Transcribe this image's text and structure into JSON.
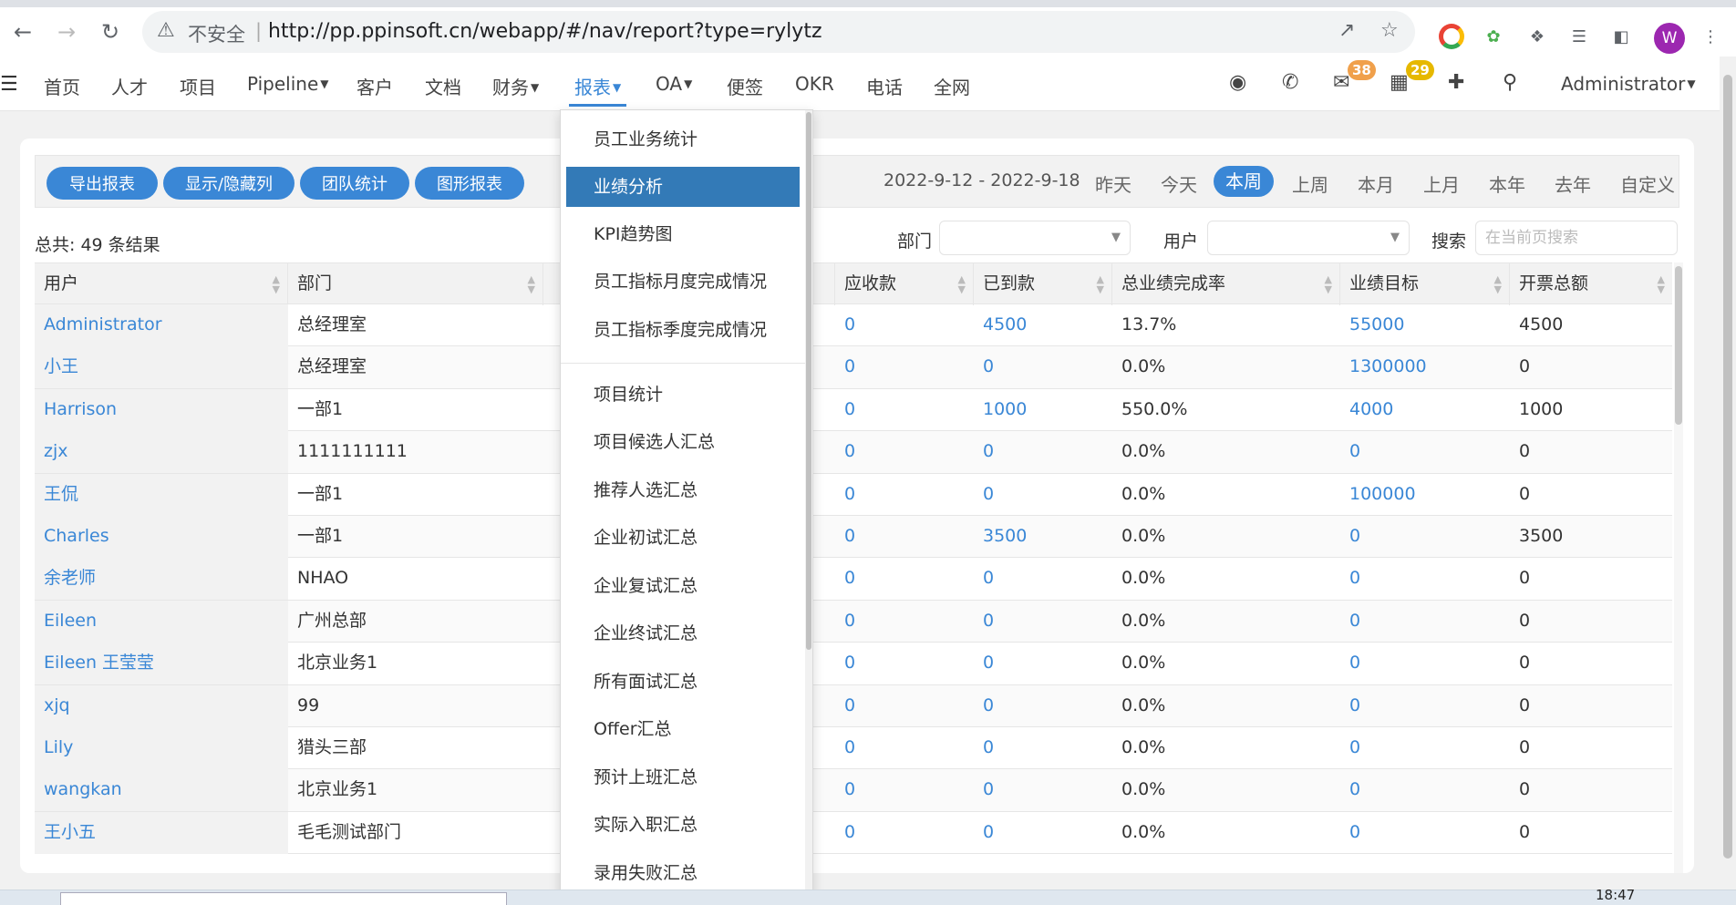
{
  "browser": {
    "insecure_label": "不安全",
    "url": "http://pp.ppinsoft.cn/webapp/#/nav/report?type=rylytz",
    "profile_initial": "W"
  },
  "nav": {
    "items": [
      "首页",
      "人才",
      "项目",
      "Pipeline",
      "客户",
      "文档",
      "财务",
      "报表",
      "OA",
      "便签",
      "OKR",
      "电话",
      "全网"
    ],
    "active": "报表",
    "mail_badge": "38",
    "calendar_badge": "29",
    "user": "Administrator",
    "colors": {
      "accent": "#3a87d6",
      "mail_badge": "#f0a04b",
      "calendar_badge": "#e6b800"
    }
  },
  "toolbar": {
    "buttons": [
      "导出报表",
      "显示/隐藏列",
      "团队统计",
      "图形报表"
    ],
    "date_range": "2022-9-12 - 2022-9-18",
    "periods": [
      "昨天",
      "今天",
      "本周",
      "上周",
      "本月",
      "上月",
      "本年",
      "去年",
      "自定义"
    ],
    "active_period": "本周"
  },
  "filters": {
    "total": "总共: 49 条结果",
    "dept_label": "部门",
    "user_label": "用户",
    "search_label": "搜索",
    "search_placeholder": "在当前页搜索"
  },
  "table": {
    "columns": [
      "用户",
      "部门",
      "应收款",
      "已到款",
      "总业绩完成率",
      "业绩目标",
      "开票总额"
    ],
    "rows": [
      {
        "user": "Administrator",
        "dept": "总经理室",
        "receivable": "0",
        "received": "4500",
        "rate": "13.7%",
        "target": "55000",
        "invoice": "4500"
      },
      {
        "user": "小王",
        "dept": "总经理室",
        "receivable": "0",
        "received": "0",
        "rate": "0.0%",
        "target": "1300000",
        "invoice": "0"
      },
      {
        "user": "Harrison",
        "dept": "一部1",
        "receivable": "0",
        "received": "1000",
        "rate": "550.0%",
        "target": "4000",
        "invoice": "1000"
      },
      {
        "user": "zjx",
        "dept": "1111111111",
        "receivable": "0",
        "received": "0",
        "rate": "0.0%",
        "target": "0",
        "invoice": "0"
      },
      {
        "user": "王侃",
        "dept": "一部1",
        "receivable": "0",
        "received": "0",
        "rate": "0.0%",
        "target": "100000",
        "invoice": "0"
      },
      {
        "user": "Charles",
        "dept": "一部1",
        "receivable": "0",
        "received": "3500",
        "rate": "0.0%",
        "target": "0",
        "invoice": "3500"
      },
      {
        "user": "余老师",
        "dept": "NHAO",
        "receivable": "0",
        "received": "0",
        "rate": "0.0%",
        "target": "0",
        "invoice": "0"
      },
      {
        "user": "Eileen",
        "dept": "广州总部",
        "receivable": "0",
        "received": "0",
        "rate": "0.0%",
        "target": "0",
        "invoice": "0"
      },
      {
        "user": "Eileen 王莹莹",
        "dept": "北京业务1",
        "receivable": "0",
        "received": "0",
        "rate": "0.0%",
        "target": "0",
        "invoice": "0"
      },
      {
        "user": "xjq",
        "dept": "99",
        "receivable": "0",
        "received": "0",
        "rate": "0.0%",
        "target": "0",
        "invoice": "0"
      },
      {
        "user": "Lily",
        "dept": "猎头三部",
        "receivable": "0",
        "received": "0",
        "rate": "0.0%",
        "target": "0",
        "invoice": "0"
      },
      {
        "user": "wangkan",
        "dept": "北京业务1",
        "receivable": "0",
        "received": "0",
        "rate": "0.0%",
        "target": "0",
        "invoice": "0"
      },
      {
        "user": "王小五",
        "dept": "毛毛测试部门",
        "receivable": "0",
        "received": "0",
        "rate": "0.0%",
        "target": "0",
        "invoice": "0"
      }
    ]
  },
  "dropdown": {
    "items": [
      "员工业务统计",
      "业绩分析",
      "KPI趋势图",
      "员工指标月度完成情况",
      "员工指标季度完成情况",
      "项目统计",
      "项目候选人汇总",
      "推荐人选汇总",
      "企业初试汇总",
      "企业复试汇总",
      "企业终试汇总",
      "所有面试汇总",
      "Offer汇总",
      "预计上班汇总",
      "实际入职汇总",
      "录用失败汇总"
    ],
    "active": "业绩分析"
  },
  "taskbar": {
    "clock": "18:47"
  }
}
